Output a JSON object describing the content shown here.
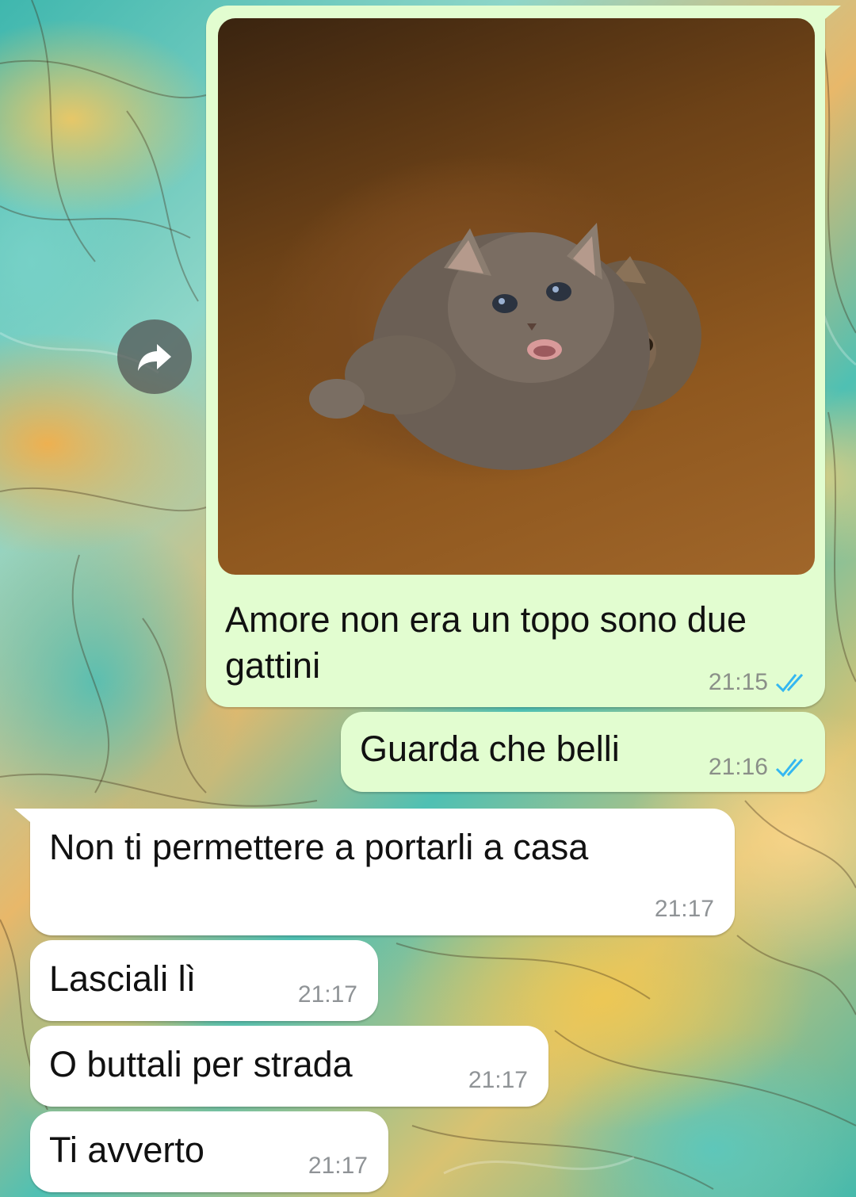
{
  "forward_button": {
    "icon": "forward-arrow-icon"
  },
  "messages": [
    {
      "direction": "outgoing",
      "type": "image",
      "image_alt": "two kittens in a cardboard box",
      "text": "Amore non era un topo sono due\ngattini",
      "time": "21:15",
      "status_icon": "double-check-read-icon"
    },
    {
      "direction": "outgoing",
      "type": "text",
      "text": "Guarda che belli",
      "time": "21:16",
      "status_icon": "double-check-read-icon"
    },
    {
      "direction": "incoming",
      "type": "text",
      "text": "Non ti permettere a portarli a casa",
      "time": "21:17"
    },
    {
      "direction": "incoming",
      "type": "text",
      "text": "Lasciali lì",
      "time": "21:17"
    },
    {
      "direction": "incoming",
      "type": "text",
      "text": "O buttali per strada",
      "time": "21:17"
    },
    {
      "direction": "incoming",
      "type": "text",
      "text": "Ti avverto",
      "time": "21:17"
    }
  ],
  "colors": {
    "outgoing_bubble": "#e2fdd0",
    "incoming_bubble": "#ffffff",
    "read_check": "#34b7f1"
  }
}
